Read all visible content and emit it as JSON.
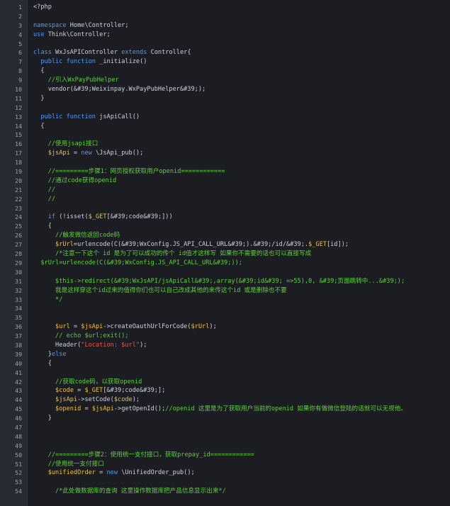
{
  "lines": [
    {
      "n": "1",
      "t": [
        [
          "",
          "<?php"
        ]
      ]
    },
    {
      "n": "2",
      "t": []
    },
    {
      "n": "3",
      "t": [
        [
          "k",
          "namespace"
        ],
        [
          "",
          " Home\\Controller;"
        ]
      ]
    },
    {
      "n": "4",
      "t": [
        [
          "k",
          "use"
        ],
        [
          "",
          " Think\\Controller;"
        ]
      ]
    },
    {
      "n": "5",
      "t": []
    },
    {
      "n": "6",
      "t": [
        [
          "k",
          "class"
        ],
        [
          "",
          " WxJsAPIController "
        ],
        [
          "k",
          "extends"
        ],
        [
          "",
          " Controller{"
        ]
      ]
    },
    {
      "n": "7",
      "t": [
        [
          "",
          "  "
        ],
        [
          "k",
          "public"
        ],
        [
          "",
          " "
        ],
        [
          "k",
          "function"
        ],
        [
          "",
          " _initialize()"
        ]
      ]
    },
    {
      "n": "8",
      "t": [
        [
          "",
          "  {"
        ]
      ]
    },
    {
      "n": "9",
      "t": [
        [
          "",
          "    "
        ],
        [
          "c",
          "//引入WxPayPubHelper"
        ]
      ]
    },
    {
      "n": "10",
      "t": [
        [
          "",
          "    vendor(&#39;Weixinpay.WxPayPubHelper&#39;);"
        ]
      ]
    },
    {
      "n": "11",
      "t": [
        [
          "",
          "  }"
        ]
      ]
    },
    {
      "n": "12",
      "t": []
    },
    {
      "n": "13",
      "t": [
        [
          "",
          "  "
        ],
        [
          "k",
          "public"
        ],
        [
          "",
          " "
        ],
        [
          "k",
          "function"
        ],
        [
          "",
          " jsApiCall()"
        ]
      ]
    },
    {
      "n": "14",
      "t": [
        [
          "",
          "  {"
        ]
      ]
    },
    {
      "n": "15",
      "t": []
    },
    {
      "n": "16",
      "t": [
        [
          "",
          "    "
        ],
        [
          "c",
          "//使用jsapi接口"
        ]
      ]
    },
    {
      "n": "17",
      "t": [
        [
          "",
          "    "
        ],
        [
          "v",
          "$jsApi"
        ],
        [
          "",
          " = "
        ],
        [
          "k",
          "new"
        ],
        [
          "",
          " \\JsApi_pub();"
        ]
      ]
    },
    {
      "n": "18",
      "t": []
    },
    {
      "n": "19",
      "t": [
        [
          "",
          "    "
        ],
        [
          "c",
          "//=========步骤1：网页授权获取用户openid============"
        ]
      ]
    },
    {
      "n": "20",
      "t": [
        [
          "",
          "    "
        ],
        [
          "c",
          "//通过code获得openid"
        ]
      ]
    },
    {
      "n": "21",
      "t": [
        [
          "",
          "    "
        ],
        [
          "c",
          "//"
        ]
      ]
    },
    {
      "n": "22",
      "t": [
        [
          "",
          "    "
        ],
        [
          "c",
          "//"
        ]
      ]
    },
    {
      "n": "23",
      "t": []
    },
    {
      "n": "24",
      "t": [
        [
          "",
          "    "
        ],
        [
          "k",
          "if"
        ],
        [
          "",
          " (!isset("
        ],
        [
          "v",
          "$_GET"
        ],
        [
          "",
          "[&#39;code&#39;]))"
        ]
      ]
    },
    {
      "n": "25",
      "t": [
        [
          "",
          "    {"
        ]
      ]
    },
    {
      "n": "26",
      "t": [
        [
          "",
          "      "
        ],
        [
          "c",
          "//触发微信返回code码"
        ]
      ]
    },
    {
      "n": "27",
      "t": [
        [
          "",
          "      "
        ],
        [
          "v",
          "$rUrl"
        ],
        [
          "",
          "=urlencode(C(&#39;WxConfig.JS_API_CALL_URL&#39;).&#39;/id/&#39;."
        ],
        [
          "v",
          "$_GET"
        ],
        [
          "",
          "[id]);"
        ]
      ]
    },
    {
      "n": "28",
      "t": [
        [
          "",
          "      "
        ],
        [
          "c",
          "/*注意一下这个 id 是为了可以成功的传个 id值才这样写 如果你不需要的话也可以直接写成"
        ]
      ]
    },
    {
      "n": "29",
      "t": [
        [
          "",
          "  "
        ],
        [
          "c",
          "$rUrl=urlencode(C(&#39;WxConfig.JS_API_CALL_URL&#39;));"
        ]
      ]
    },
    {
      "n": "30",
      "t": []
    },
    {
      "n": "31",
      "t": [
        [
          "",
          "      "
        ],
        [
          "c",
          "$this->redirect(&#39;WxJsAPI/jsApiCall&#39;,array(&#39;id&#39; =>55),0, &#39;页面跳转中...&#39;);"
        ]
      ]
    },
    {
      "n": "32",
      "t": [
        [
          "",
          "      "
        ],
        [
          "c",
          "我是这样穿这个id过来的值得你们也可以自己改成其他的来传这个id 或是删除也不要"
        ]
      ]
    },
    {
      "n": "33",
      "t": [
        [
          "",
          "      "
        ],
        [
          "c",
          "*/"
        ]
      ]
    },
    {
      "n": "34",
      "t": []
    },
    {
      "n": "35",
      "t": []
    },
    {
      "n": "36",
      "t": [
        [
          "",
          "      "
        ],
        [
          "v",
          "$url"
        ],
        [
          "",
          " = "
        ],
        [
          "v",
          "$jsApi"
        ],
        [
          "",
          "->createOauthUrlForCode("
        ],
        [
          "v",
          "$rUrl"
        ],
        [
          "",
          ");"
        ]
      ]
    },
    {
      "n": "37",
      "t": [
        [
          "",
          "      "
        ],
        [
          "c",
          "// echo $url;exit();"
        ]
      ]
    },
    {
      "n": "38",
      "t": [
        [
          "",
          "      Header("
        ],
        [
          "s",
          "\"Location: $url\""
        ],
        [
          "",
          ");"
        ]
      ]
    },
    {
      "n": "39",
      "t": [
        [
          "",
          "    }"
        ],
        [
          "k",
          "else"
        ]
      ]
    },
    {
      "n": "40",
      "t": [
        [
          "",
          "    {"
        ]
      ]
    },
    {
      "n": "41",
      "t": []
    },
    {
      "n": "42",
      "t": [
        [
          "",
          "      "
        ],
        [
          "c",
          "//获取code码，以获取openid"
        ]
      ]
    },
    {
      "n": "43",
      "t": [
        [
          "",
          "      "
        ],
        [
          "v",
          "$code"
        ],
        [
          "",
          " = "
        ],
        [
          "v",
          "$_GET"
        ],
        [
          "",
          "[&#39;code&#39;];"
        ]
      ]
    },
    {
      "n": "44",
      "t": [
        [
          "",
          "      "
        ],
        [
          "v",
          "$jsApi"
        ],
        [
          "",
          "->setCode("
        ],
        [
          "v",
          "$code"
        ],
        [
          "",
          ");"
        ]
      ]
    },
    {
      "n": "45",
      "t": [
        [
          "",
          "      "
        ],
        [
          "v",
          "$openid"
        ],
        [
          "",
          " = "
        ],
        [
          "v",
          "$jsApi"
        ],
        [
          "",
          "->getOpenId();"
        ],
        [
          "c",
          "//openid 这里是为了获取用户当前的openid 如果你有做微信登陆的话就可以无视他。"
        ]
      ]
    },
    {
      "n": "46",
      "t": [
        [
          "",
          "    }"
        ]
      ]
    },
    {
      "n": "47",
      "t": []
    },
    {
      "n": "48",
      "t": []
    },
    {
      "n": "49",
      "t": []
    },
    {
      "n": "50",
      "t": [
        [
          "",
          "    "
        ],
        [
          "c",
          "//=========步骤2：使用统一支付接口，获取prepay_id============"
        ]
      ]
    },
    {
      "n": "51",
      "t": [
        [
          "",
          "    "
        ],
        [
          "c",
          "//使用统一支付接口"
        ]
      ]
    },
    {
      "n": "52",
      "t": [
        [
          "",
          "    "
        ],
        [
          "v",
          "$unifiedOrder"
        ],
        [
          "",
          " = "
        ],
        [
          "k",
          "new"
        ],
        [
          "",
          " \\UnifiedOrder_pub();"
        ]
      ]
    },
    {
      "n": "53",
      "t": []
    },
    {
      "n": "54",
      "t": [
        [
          "",
          "      "
        ],
        [
          "c",
          "/*此处做数据库的查询 这里操作数据库把产品信息显示出来*/"
        ]
      ]
    }
  ]
}
